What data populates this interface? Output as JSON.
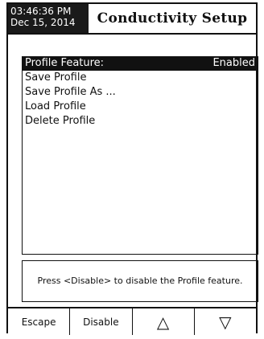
{
  "header": {
    "time": "03:46:36 PM",
    "date": "Dec 15, 2014",
    "title": "Conductivity Setup"
  },
  "menu": {
    "items": [
      {
        "label": "Profile Feature:",
        "value": "Enabled",
        "selected": true
      },
      {
        "label": "Save Profile",
        "value": ""
      },
      {
        "label": "Save Profile As ...",
        "value": ""
      },
      {
        "label": "Load Profile",
        "value": ""
      },
      {
        "label": "Delete Profile",
        "value": ""
      }
    ]
  },
  "help": {
    "text": "Press <Disable> to disable the Profile feature."
  },
  "softkeys": {
    "escape_label": "Escape",
    "disable_label": "Disable",
    "up_icon": "triangle-up-icon",
    "down_icon": "triangle-down-icon",
    "up_glyph": "△",
    "down_glyph": "▽"
  }
}
